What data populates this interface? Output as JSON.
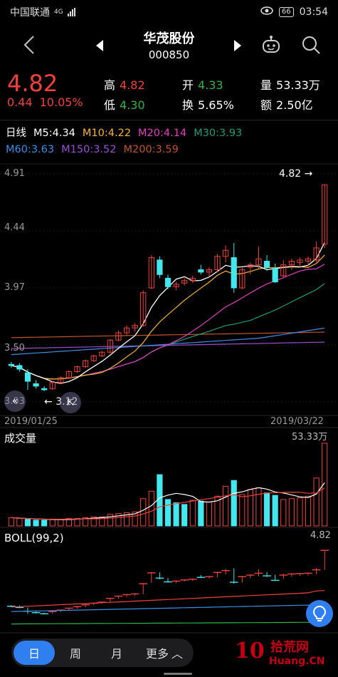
{
  "status_bar": {
    "carrier": "中国联通",
    "network": "4G",
    "battery": "66",
    "time": "03:54"
  },
  "header": {
    "stock_name": "华茂股份",
    "stock_code": "000850"
  },
  "quote": {
    "price": "4.82",
    "change": "0.44",
    "change_pct": "10.05%",
    "high_label": "高",
    "high": "4.82",
    "low_label": "低",
    "low": "4.30",
    "open_label": "开",
    "open": "4.33",
    "turnover_label": "换",
    "turnover": "5.65%",
    "volume_label": "量",
    "volume": "53.33万",
    "amount_label": "额",
    "amount": "2.50亿"
  },
  "ma_legend": {
    "period": "日线",
    "ma5": "M5:4.34",
    "ma10": "M10:4.22",
    "ma20": "M20:4.14",
    "ma30": "M30:3.93",
    "ma60": "M60:3.63",
    "ma150": "M150:3.52",
    "ma200": "M200:3.59"
  },
  "colors": {
    "up": "#f0423a",
    "down": "#43e7ee",
    "ma5": "#ffffff",
    "ma10": "#f5b433",
    "ma20": "#e33fc0",
    "ma30": "#1c9b78",
    "ma60": "#3c8fe6",
    "ma150": "#9a4fd0",
    "ma200": "#c0552a",
    "accent": "#2f7ff1"
  },
  "price_chart": {
    "y_ticks": [
      "4.91",
      "4.44",
      "3.97",
      "3.50",
      "3.03"
    ],
    "start_date": "2019/01/25",
    "end_date": "2019/03/22",
    "max_annotation": "4.82",
    "min_annotation": "3.12"
  },
  "volume_chart": {
    "label": "成交量",
    "max_annotation": "53.33万"
  },
  "boll_chart": {
    "label": "BOLL(99,2)",
    "max_annotation": "4.82"
  },
  "bottom_tabs": [
    "日",
    "周",
    "月",
    "更多"
  ],
  "logo": {
    "number": "10",
    "cn": "拾荒网",
    "url": "Huang.CN"
  },
  "chart_data": {
    "type": "candlestick",
    "title": "",
    "ylim": [
      3.03,
      4.91
    ],
    "candles": [
      {
        "o": 3.34,
        "h": 3.36,
        "l": 3.31,
        "c": 3.33
      },
      {
        "o": 3.33,
        "h": 3.35,
        "l": 3.28,
        "c": 3.3
      },
      {
        "o": 3.27,
        "h": 3.3,
        "l": 3.13,
        "c": 3.2
      },
      {
        "o": 3.18,
        "h": 3.21,
        "l": 3.14,
        "c": 3.16
      },
      {
        "o": 3.14,
        "h": 3.16,
        "l": 3.12,
        "c": 3.13
      },
      {
        "o": 3.14,
        "h": 3.2,
        "l": 3.13,
        "c": 3.19
      },
      {
        "o": 3.19,
        "h": 3.24,
        "l": 3.18,
        "c": 3.23
      },
      {
        "o": 3.23,
        "h": 3.29,
        "l": 3.22,
        "c": 3.28
      },
      {
        "o": 3.28,
        "h": 3.33,
        "l": 3.27,
        "c": 3.32
      },
      {
        "o": 3.32,
        "h": 3.38,
        "l": 3.31,
        "c": 3.37
      },
      {
        "o": 3.37,
        "h": 3.42,
        "l": 3.36,
        "c": 3.41
      },
      {
        "o": 3.41,
        "h": 3.45,
        "l": 3.4,
        "c": 3.44
      },
      {
        "o": 3.44,
        "h": 3.55,
        "l": 3.43,
        "c": 3.54
      },
      {
        "o": 3.54,
        "h": 3.62,
        "l": 3.53,
        "c": 3.6
      },
      {
        "o": 3.6,
        "h": 3.66,
        "l": 3.58,
        "c": 3.64
      },
      {
        "o": 3.64,
        "h": 3.68,
        "l": 3.61,
        "c": 3.66
      },
      {
        "o": 3.66,
        "h": 3.95,
        "l": 3.65,
        "c": 3.93
      },
      {
        "o": 3.97,
        "h": 4.24,
        "l": 3.96,
        "c": 4.22
      },
      {
        "o": 4.2,
        "h": 4.23,
        "l": 4.05,
        "c": 4.08
      },
      {
        "o": 4.05,
        "h": 4.08,
        "l": 3.96,
        "c": 3.98
      },
      {
        "o": 3.98,
        "h": 4.02,
        "l": 3.95,
        "c": 4.0
      },
      {
        "o": 4.01,
        "h": 4.05,
        "l": 3.99,
        "c": 4.03
      },
      {
        "o": 4.03,
        "h": 4.07,
        "l": 4.01,
        "c": 4.05
      },
      {
        "o": 4.12,
        "h": 4.16,
        "l": 4.08,
        "c": 4.1
      },
      {
        "o": 4.1,
        "h": 4.14,
        "l": 4.06,
        "c": 4.12
      },
      {
        "o": 4.12,
        "h": 4.25,
        "l": 4.1,
        "c": 4.23
      },
      {
        "o": 4.23,
        "h": 4.32,
        "l": 4.18,
        "c": 4.28
      },
      {
        "o": 4.22,
        "h": 4.34,
        "l": 3.93,
        "c": 3.97
      },
      {
        "o": 3.97,
        "h": 4.14,
        "l": 3.96,
        "c": 4.12
      },
      {
        "o": 4.14,
        "h": 4.18,
        "l": 4.08,
        "c": 4.16
      },
      {
        "o": 4.16,
        "h": 4.31,
        "l": 4.13,
        "c": 4.21
      },
      {
        "o": 4.19,
        "h": 4.24,
        "l": 4.11,
        "c": 4.14
      },
      {
        "o": 4.13,
        "h": 4.17,
        "l": 4.01,
        "c": 4.02
      },
      {
        "o": 4.07,
        "h": 4.2,
        "l": 4.06,
        "c": 4.16
      },
      {
        "o": 4.16,
        "h": 4.21,
        "l": 4.12,
        "c": 4.19
      },
      {
        "o": 4.18,
        "h": 4.22,
        "l": 4.14,
        "c": 4.2
      },
      {
        "o": 4.19,
        "h": 4.23,
        "l": 4.15,
        "c": 4.21
      },
      {
        "o": 4.2,
        "h": 4.35,
        "l": 4.18,
        "c": 4.3
      },
      {
        "o": 4.33,
        "h": 4.82,
        "l": 4.3,
        "c": 4.82
      }
    ],
    "volume": [
      10,
      9,
      8,
      7,
      7,
      8,
      8,
      9,
      9,
      10,
      11,
      11,
      14,
      15,
      16,
      17,
      33,
      42,
      62,
      32,
      28,
      26,
      31,
      30,
      29,
      36,
      48,
      55,
      38,
      44,
      46,
      40,
      37,
      32,
      33,
      34,
      36,
      58,
      100
    ],
    "volume_down_flags": [
      false,
      false,
      true,
      true,
      true,
      false,
      false,
      false,
      false,
      false,
      false,
      false,
      false,
      false,
      false,
      false,
      false,
      false,
      true,
      true,
      true,
      true,
      false,
      true,
      false,
      false,
      false,
      true,
      false,
      false,
      false,
      true,
      true,
      false,
      false,
      false,
      false,
      false,
      false
    ]
  }
}
